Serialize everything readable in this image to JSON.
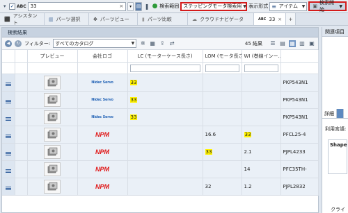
{
  "toolbar": {
    "abc_label": "ABC",
    "search_value": "33",
    "search_scope_label": "検索範囲",
    "search_scope_value": "ステッピングモータ検索用",
    "display_format_label": "表示形式",
    "display_format_value": "アイテム",
    "search_start_label": "検索開始"
  },
  "tabs": [
    {
      "label": "アシスタント"
    },
    {
      "label": "パーツ選択"
    },
    {
      "label": "パーツビュー"
    },
    {
      "label": "パーツ比較"
    },
    {
      "label": "クラウドナビゲータ"
    },
    {
      "label": "ABC",
      "badge": "33"
    }
  ],
  "results": {
    "panel_title": "検索結果",
    "filter_label": "フィルター:",
    "catalog_value": "すべてのカタログ",
    "count_text": "45 結果",
    "columns": [
      "プレビュー",
      "会社ロゴ",
      "LC (モーターケース長さ)",
      "LOM (モータ長さ)",
      "WI (巻線インー…",
      ""
    ],
    "rows": [
      {
        "logo": "blue",
        "logo_text": "Nidec Servo",
        "lc": "33",
        "lom": "",
        "wi": "",
        "part": "PKP543N1"
      },
      {
        "logo": "blue",
        "logo_text": "Nidec Servo",
        "lc": "33",
        "lom": "",
        "wi": "",
        "part": "PKP543N1"
      },
      {
        "logo": "blue",
        "logo_text": "Nidec Servo",
        "lc": "33",
        "lom": "",
        "wi": "",
        "part": "PKP543N1"
      },
      {
        "logo": "npm",
        "logo_text": "NPM",
        "lc": "",
        "lom": "16.6",
        "wi": "33",
        "part": "PFCL25-4"
      },
      {
        "logo": "npm",
        "logo_text": "NPM",
        "lc": "",
        "lom": "33",
        "wi": "2.1",
        "part": "PJPL4233"
      },
      {
        "logo": "npm",
        "logo_text": "NPM",
        "lc": "",
        "lom": "",
        "wi": "14",
        "part": "PFC35TH-"
      },
      {
        "logo": "npm",
        "logo_text": "NPM",
        "lc": "",
        "lom": "32",
        "wi": "1.2",
        "part": "PJPL2832"
      }
    ],
    "highlight": {
      "0": [
        "lc"
      ],
      "1": [
        "lc"
      ],
      "2": [
        "lc"
      ],
      "3": [
        "wi"
      ],
      "4": [
        "lom"
      ]
    }
  },
  "side": {
    "header": "関連項目",
    "tab_detail": "詳細",
    "usage_label": "利用言語:",
    "shape_label": "Shape",
    "cluster_label": "クライ"
  },
  "colors": {
    "accent_red": "#d41b1b",
    "highlight_yellow": "#fff200",
    "npm_red": "#e01515"
  }
}
